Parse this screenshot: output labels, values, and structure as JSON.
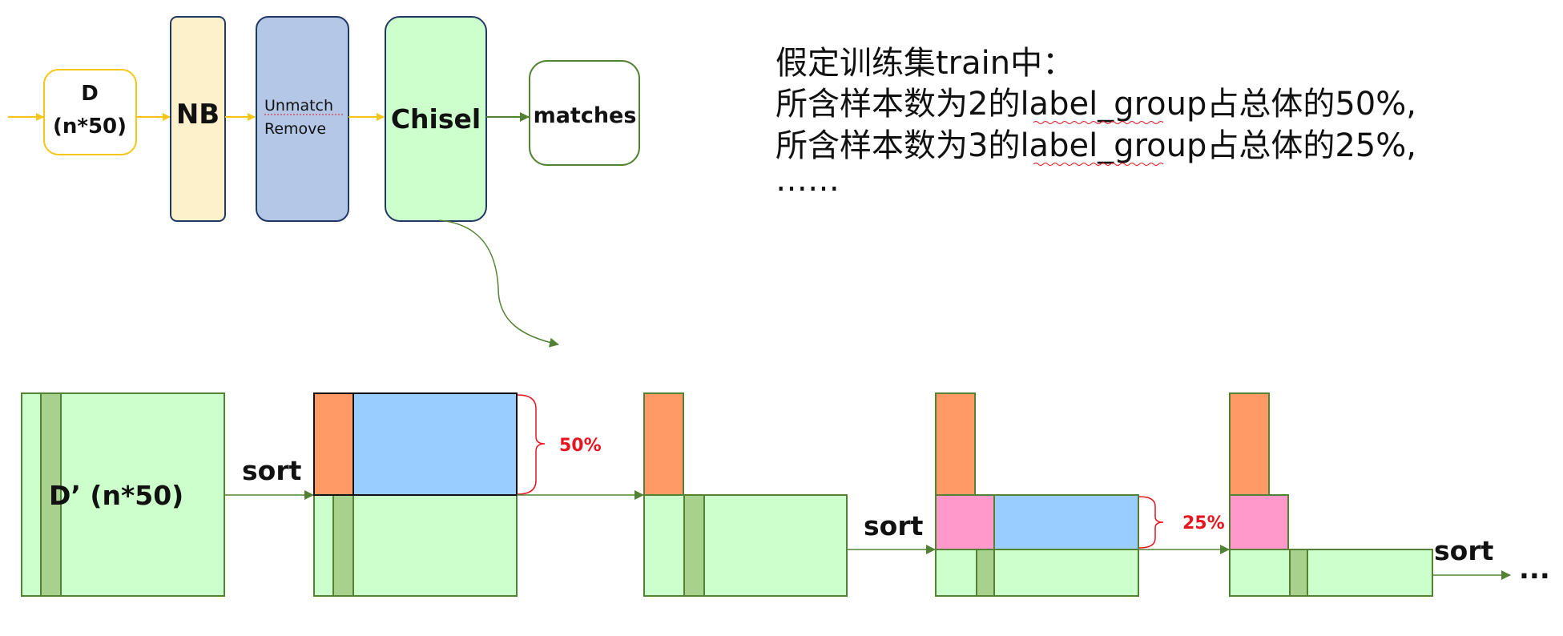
{
  "pipeline": {
    "d_line1": "D",
    "d_line2": "(n*50)",
    "nb": "NB",
    "unmatch_line1": "Unmatch",
    "unmatch_line2": "Remove",
    "chisel": "Chisel",
    "matches": "matches"
  },
  "note": {
    "line1": "假定训练集train中：",
    "line2": "所含样本数为2的label_group占总体的50%,",
    "line3": "所含样本数为3的label_group占总体的25%,",
    "line4": "……"
  },
  "steps": {
    "matrix_label": "D’ (n*50)",
    "sort1": "sort",
    "sort2": "sort",
    "sort3": "sort",
    "pct50": "50%",
    "pct25": "25%",
    "ellipsis": "..."
  },
  "colors": {
    "yellow_border": "#f5c518",
    "nb_fill": "#fdf1cc",
    "unmatch_fill": "#b4c7e7",
    "box_fill": "#ccffcc",
    "dark_green_fill": "#a9d18e",
    "green_border": "#538135",
    "orange": "#ff9966",
    "blue": "#99ccff",
    "pink": "#ff99cc",
    "red": "#e8141e"
  }
}
